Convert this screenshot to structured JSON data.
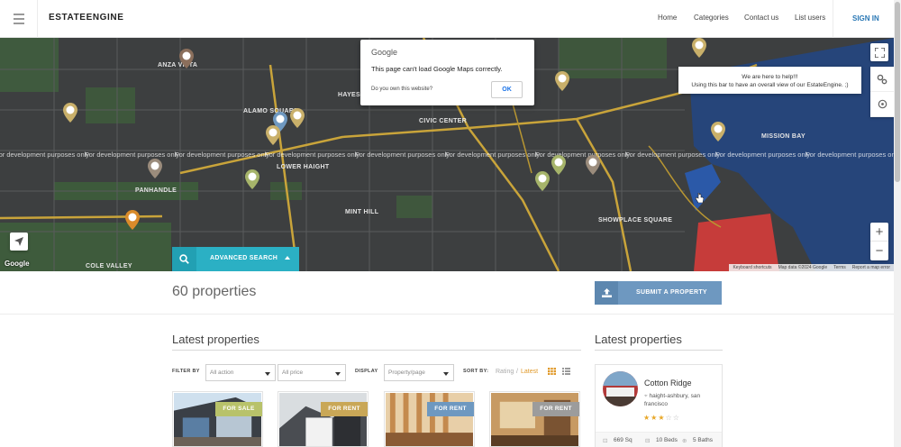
{
  "header": {
    "logo": "ESTATEENGINE",
    "nav": [
      "Home",
      "Categories",
      "Contact us",
      "List users"
    ],
    "signin": "SIGN IN"
  },
  "map": {
    "dev_text": "For development purposes only",
    "labels": [
      "ANZA VISTA",
      "LOWER HAIGHT",
      "HAYES VALLEY",
      "CIVIC CENTER",
      "MINT HILL",
      "SHOWPLACE SQUARE",
      "MISSION BAY",
      "ALAMO SQUARE",
      "COLE VALLEY",
      "PANHANDLE"
    ],
    "google_mark": "Google",
    "attribution": [
      "Keyboard shortcuts",
      "Map data ©2024 Google",
      "Terms",
      "Report a map error"
    ],
    "dialog": {
      "brand": "Google",
      "message": "This page can't load Google Maps correctly.",
      "own_question": "Do you own this website?",
      "ok": "OK"
    },
    "help_line1": "We are here to help!!!",
    "help_line2": "Using this bar to have an overall view of our EstateEngine. ;)",
    "advanced_search": "ADVANCED SEARCH"
  },
  "content": {
    "properties_count": "60 properties",
    "submit_button": "SUBMIT A PROPERTY",
    "latest_title": "Latest properties",
    "sidebar_title": "Latest properties",
    "filter": {
      "filter_by": "FILTER BY",
      "action_value": "All action",
      "price_value": "All price",
      "display": "DISPLAY",
      "per_page": "Property/page",
      "sort_by": "SORT BY:",
      "sort_rating": "Rating",
      "sort_sep": "/",
      "sort_latest": "Latest"
    },
    "cards": [
      {
        "badge": "FOR SALE",
        "badge_color": "#b8c26a"
      },
      {
        "badge": "FOR RENT",
        "badge_color": "#c9a757"
      },
      {
        "badge": "FOR RENT",
        "badge_color": "#6e98c0"
      },
      {
        "badge": "FOR RENT",
        "badge_color": "#9c9c9c"
      }
    ],
    "featured": {
      "name": "Cotton Ridge",
      "address": "haight-ashbury, san francisco",
      "rating": 3,
      "rating_max": 5,
      "area": "669 Sq",
      "beds": "10 Beds",
      "baths": "5 Baths"
    }
  },
  "colors": {
    "accent_teal": "#2bb0c4",
    "submit_blue": "#6e98c0",
    "signin_blue": "#2a78b5",
    "sort_active": "#e09a2b",
    "star": "#e8a728"
  }
}
